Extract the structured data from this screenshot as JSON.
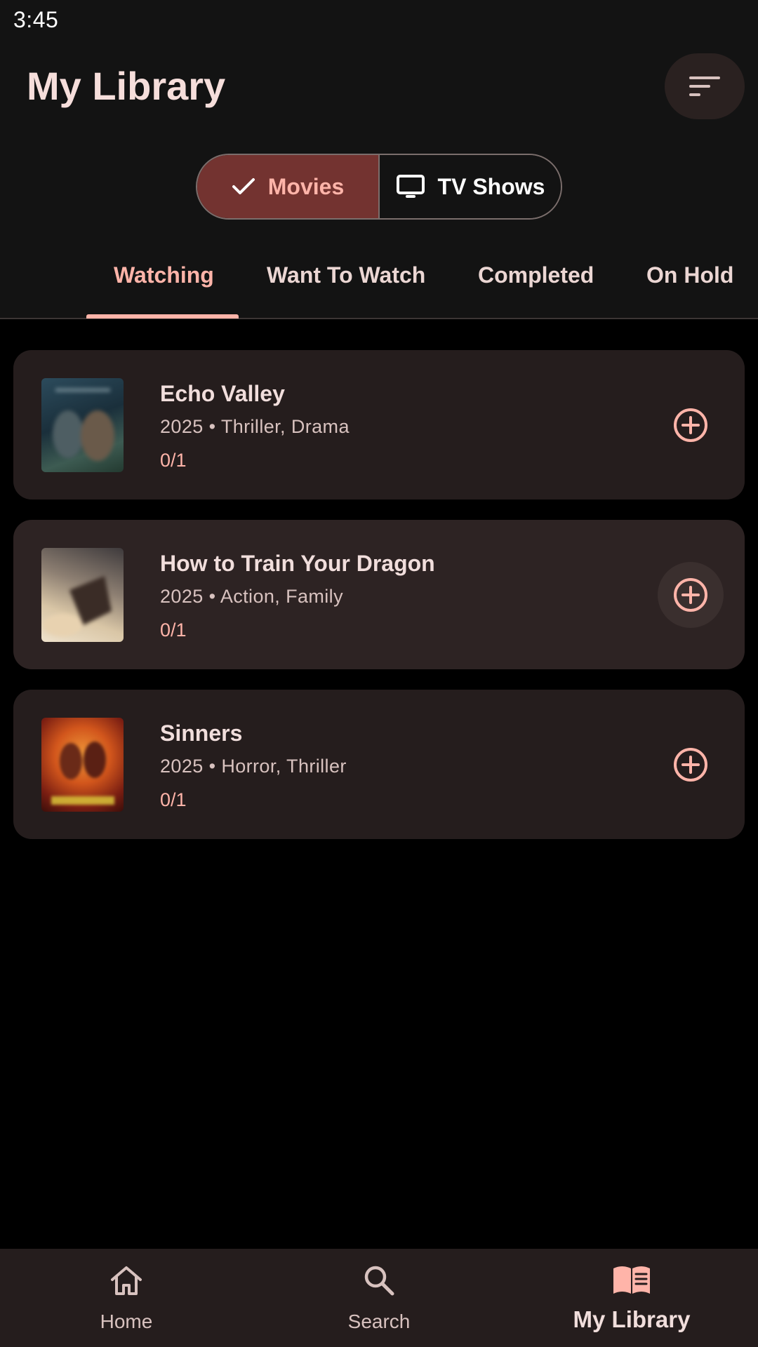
{
  "status_bar": {
    "time": "3:45"
  },
  "header": {
    "title": "My Library",
    "sort_icon": "sort-lines-icon"
  },
  "segmented": {
    "options": [
      {
        "label": "Movies",
        "icon": "check-icon",
        "selected": true
      },
      {
        "label": "TV Shows",
        "icon": "tv-icon",
        "selected": false
      }
    ]
  },
  "tabs": [
    {
      "label": "Watching",
      "active": true
    },
    {
      "label": "Want To Watch",
      "active": false
    },
    {
      "label": "Completed",
      "active": false
    },
    {
      "label": "On Hold",
      "active": false
    }
  ],
  "items": [
    {
      "title": "Echo Valley",
      "meta": "2025 • Thriller, Drama",
      "progress": "0/1",
      "poster_colors": [
        "#1f3a4a",
        "#3c5a5e"
      ]
    },
    {
      "title": "How to Train Your Dragon",
      "meta": "2025 • Action, Family",
      "progress": "0/1",
      "poster_colors": [
        "#c9b59a",
        "#4a3a30"
      ]
    },
    {
      "title": "Sinners",
      "meta": "2025 • Horror, Thriller",
      "progress": "0/1",
      "poster_colors": [
        "#d2641e",
        "#5a1a10"
      ]
    }
  ],
  "bottom_nav": [
    {
      "label": "Home",
      "icon": "home-icon",
      "active": false
    },
    {
      "label": "Search",
      "icon": "search-icon",
      "active": false
    },
    {
      "label": "My Library",
      "icon": "library-book-icon",
      "active": true
    }
  ],
  "colors": {
    "accent": "#ffb4a9",
    "selected_segment": "#733330",
    "card": "#251d1d"
  }
}
